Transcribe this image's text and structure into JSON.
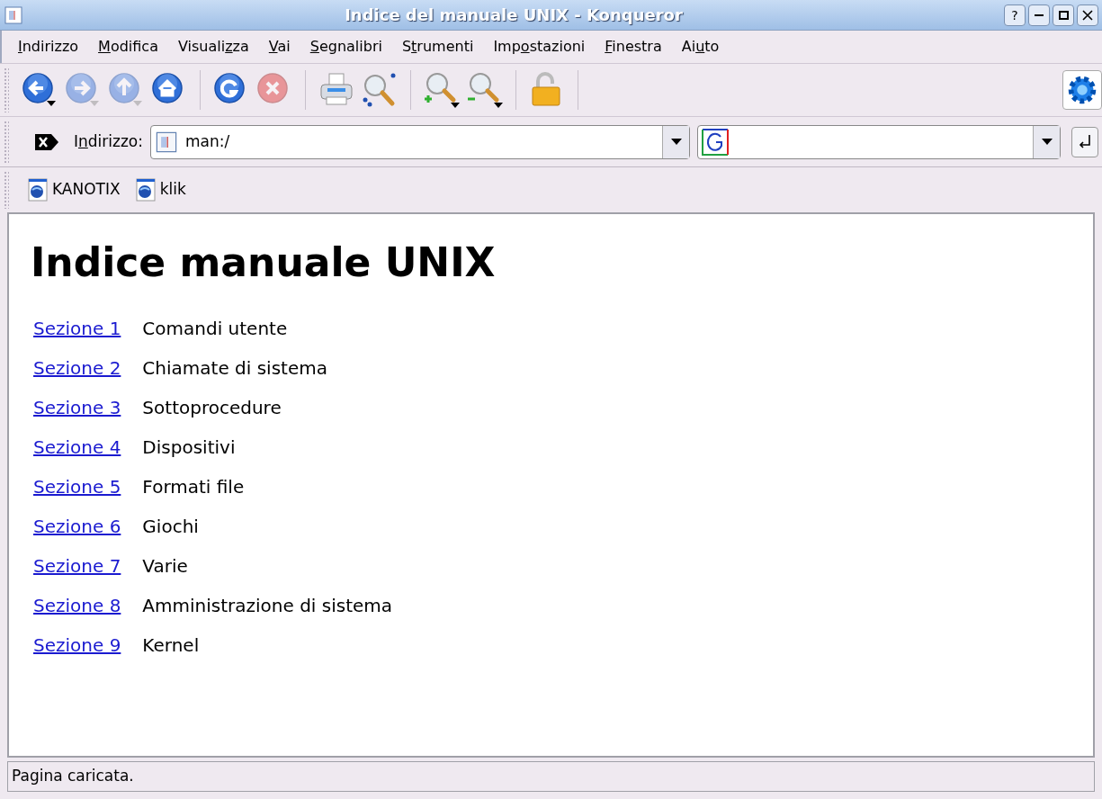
{
  "window": {
    "title": "Indice del manuale UNIX - Konqueror",
    "buttons": [
      "?"
    ]
  },
  "menu": [
    {
      "key": "I",
      "after": "ndirizzo"
    },
    {
      "key": "M",
      "after": "odifica"
    },
    {
      "before": "Visuali",
      "key": "z",
      "after": "za"
    },
    {
      "key": "V",
      "after": "ai"
    },
    {
      "key": "S",
      "after": "egnalibri"
    },
    {
      "before": "S",
      "key": "t",
      "after": "rumenti"
    },
    {
      "before": "Imp",
      "key": "o",
      "after": "stazioni"
    },
    {
      "key": "F",
      "after": "inestra"
    },
    {
      "before": "Ai",
      "key": "u",
      "after": "to"
    }
  ],
  "toolbar": [
    {
      "kind": "back",
      "disabled": false,
      "dropdown": true
    },
    {
      "kind": "forward",
      "disabled": true,
      "dropdown": true
    },
    {
      "kind": "up",
      "disabled": true,
      "dropdown": true
    },
    {
      "kind": "home",
      "disabled": false,
      "dropdown": false
    },
    {
      "kind": "sep"
    },
    {
      "kind": "reload",
      "disabled": false,
      "dropdown": false
    },
    {
      "kind": "stop",
      "disabled": true,
      "dropdown": false
    },
    {
      "kind": "sep"
    },
    {
      "kind": "print",
      "disabled": false,
      "dropdown": false
    },
    {
      "kind": "find",
      "disabled": false,
      "dropdown": false
    },
    {
      "kind": "sep"
    },
    {
      "kind": "zoomin",
      "disabled": false,
      "dropdown": true
    },
    {
      "kind": "zoomout",
      "disabled": false,
      "dropdown": true
    },
    {
      "kind": "sep"
    },
    {
      "kind": "lock",
      "disabled": false,
      "dropdown": false
    },
    {
      "kind": "sep"
    }
  ],
  "address": {
    "label": {
      "before": "I",
      "key": "n",
      "after": "dirizzo:"
    },
    "value": "man:/"
  },
  "bookmarks": [
    "KANOTIX",
    "klik"
  ],
  "page": {
    "heading": "Indice manuale UNIX",
    "sections": [
      {
        "link": "Sezione 1",
        "text": "Comandi utente"
      },
      {
        "link": "Sezione 2",
        "text": "Chiamate di sistema"
      },
      {
        "link": "Sezione 3",
        "text": "Sottoprocedure"
      },
      {
        "link": "Sezione 4",
        "text": "Dispositivi"
      },
      {
        "link": "Sezione 5",
        "text": "Formati file"
      },
      {
        "link": "Sezione 6",
        "text": "Giochi"
      },
      {
        "link": "Sezione 7",
        "text": "Varie"
      },
      {
        "link": "Sezione 8",
        "text": "Amministrazione di sistema"
      },
      {
        "link": "Sezione 9",
        "text": "Kernel"
      }
    ]
  },
  "status_bar": "Pagina caricata."
}
